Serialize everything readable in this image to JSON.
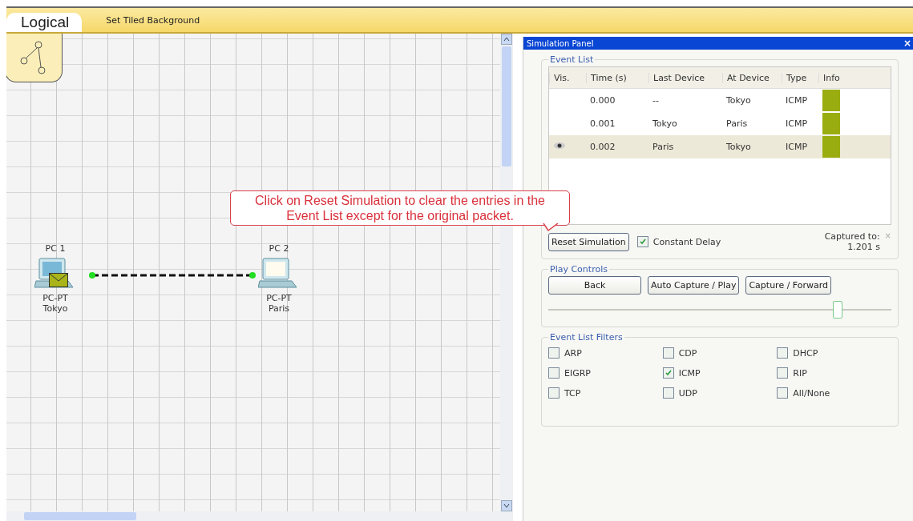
{
  "toolbar": {
    "view_tab": "Logical",
    "action": "Set Tiled Background"
  },
  "canvas": {
    "devices": [
      {
        "name": "PC 1",
        "model": "PC-PT",
        "label": "Tokyo",
        "has_packet": true
      },
      {
        "name": "PC 2",
        "model": "PC-PT",
        "label": "Paris",
        "has_packet": false
      }
    ],
    "callout": "Click on Reset Simulation to clear the entries in the Event List except for the original packet."
  },
  "panel": {
    "title": "Simulation Panel",
    "close": "×",
    "event_list": {
      "title": "Event List",
      "columns": [
        "Vis.",
        "Time (s)",
        "Last Device",
        "At Device",
        "Type",
        "Info"
      ],
      "rows": [
        {
          "time": "0.000",
          "last_device": "--",
          "at_device": "Tokyo",
          "type": "ICMP",
          "color": "#9aad10",
          "visible": false,
          "selected": false
        },
        {
          "time": "0.001",
          "last_device": "Tokyo",
          "at_device": "Paris",
          "type": "ICMP",
          "color": "#9aad10",
          "visible": false,
          "selected": false
        },
        {
          "time": "0.002",
          "last_device": "Paris",
          "at_device": "Tokyo",
          "type": "ICMP",
          "color": "#9aad10",
          "visible": true,
          "selected": true
        }
      ],
      "reset_button": "Reset Simulation",
      "constant_delay": {
        "label": "Constant Delay",
        "checked": true
      },
      "captured_label": "Captured to:",
      "captured_value": "1.201 s",
      "captured_close": "×"
    },
    "play_controls": {
      "title": "Play Controls",
      "buttons": [
        "Back",
        "Auto Capture / Play",
        "Capture / Forward"
      ],
      "level": 0.84
    },
    "filters": {
      "title": "Event List Filters",
      "items": [
        {
          "label": "ARP",
          "checked": false
        },
        {
          "label": "CDP",
          "checked": false
        },
        {
          "label": "DHCP",
          "checked": false
        },
        {
          "label": "EIGRP",
          "checked": false
        },
        {
          "label": "ICMP",
          "checked": true
        },
        {
          "label": "RIP",
          "checked": false
        },
        {
          "label": "TCP",
          "checked": false
        },
        {
          "label": "UDP",
          "checked": false
        },
        {
          "label": "All/None",
          "checked": false
        }
      ]
    }
  }
}
